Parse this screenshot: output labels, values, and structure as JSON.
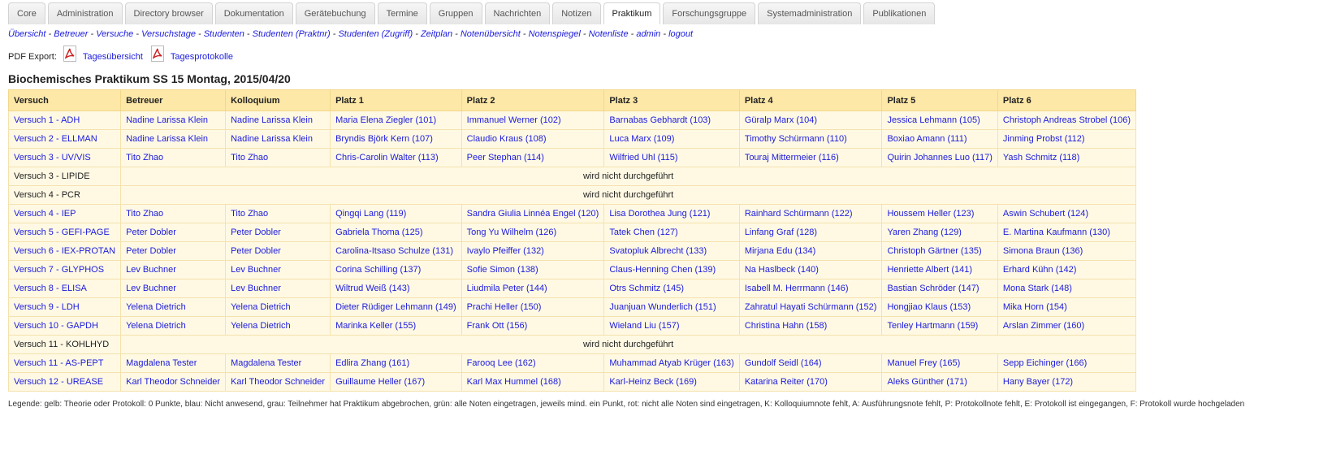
{
  "tabs": [
    {
      "label": "Core",
      "active": false
    },
    {
      "label": "Administration",
      "active": false
    },
    {
      "label": "Directory browser",
      "active": false
    },
    {
      "label": "Dokumentation",
      "active": false
    },
    {
      "label": "Gerätebuchung",
      "active": false
    },
    {
      "label": "Termine",
      "active": false
    },
    {
      "label": "Gruppen",
      "active": false
    },
    {
      "label": "Nachrichten",
      "active": false
    },
    {
      "label": "Notizen",
      "active": false
    },
    {
      "label": "Praktikum",
      "active": true
    },
    {
      "label": "Forschungsgruppe",
      "active": false
    },
    {
      "label": "Systemadministration",
      "active": false
    },
    {
      "label": "Publikationen",
      "active": false
    }
  ],
  "subnav": {
    "separator": " - ",
    "links": [
      "Übersicht",
      "Betreuer",
      "Versuche",
      "Versuchstage",
      "Studenten",
      "Studenten (Praktnr)",
      "Studenten (Zugriff)",
      "Zeitplan",
      "Notenübersicht",
      "Notenspiegel",
      "Notenliste",
      "admin",
      "logout"
    ]
  },
  "pdf_export": {
    "label": "PDF Export:",
    "links": [
      "Tagesübersicht",
      "Tagesprotokolle"
    ]
  },
  "page_title": "Biochemisches Praktikum SS 15 Montag, 2015/04/20",
  "table": {
    "headers": [
      "Versuch",
      "Betreuer",
      "Kolloquium",
      "Platz 1",
      "Platz 2",
      "Platz 3",
      "Platz 4",
      "Platz 5",
      "Platz 6"
    ],
    "rows": [
      {
        "versuch": "Versuch 1 - ADH",
        "cells": [
          "Nadine Larissa Klein",
          "Nadine Larissa Klein",
          "Maria Elena Ziegler (101)",
          "Immanuel Werner (102)",
          "Barnabas Gebhardt (103)",
          "Güralp Marx (104)",
          "Jessica Lehmann (105)",
          "Christoph Andreas Strobel (106)"
        ]
      },
      {
        "versuch": "Versuch 2 - ELLMAN",
        "cells": [
          "Nadine Larissa Klein",
          "Nadine Larissa Klein",
          "Bryndis Björk Kern (107)",
          "Claudio Kraus (108)",
          "Luca Marx (109)",
          "Timothy Schürmann (110)",
          "Boxiao Amann (111)",
          "Jinming Probst (112)"
        ]
      },
      {
        "versuch": "Versuch 3 - UV/VIS",
        "cells": [
          "Tito Zhao",
          "Tito Zhao",
          "Chris-Carolin Walter (113)",
          "Peer Stephan (114)",
          "Wilfried Uhl (115)",
          "Touraj Mittermeier (116)",
          "Quirin Johannes Luo (117)",
          "Yash Schmitz (118)"
        ]
      },
      {
        "versuch": "Versuch 3 - LIPIDE",
        "skipped": "wird nicht durchgeführt"
      },
      {
        "versuch": "Versuch 4 - PCR",
        "skipped": "wird nicht durchgeführt"
      },
      {
        "versuch": "Versuch 4 - IEP",
        "cells": [
          "Tito Zhao",
          "Tito Zhao",
          "Qingqi Lang (119)",
          "Sandra Giulia Linnéa Engel (120)",
          "Lisa Dorothea Jung (121)",
          "Rainhard Schürmann (122)",
          "Houssem Heller (123)",
          "Aswin Schubert (124)"
        ]
      },
      {
        "versuch": "Versuch 5 - GEFI-PAGE",
        "cells": [
          "Peter Dobler",
          "Peter Dobler",
          "Gabriela Thoma (125)",
          "Tong Yu Wilhelm (126)",
          "Tatek Chen (127)",
          "Linfang Graf (128)",
          "Yaren Zhang (129)",
          "E. Martina Kaufmann (130)"
        ]
      },
      {
        "versuch": "Versuch 6 - IEX-PROTAN",
        "cells": [
          "Peter Dobler",
          "Peter Dobler",
          "Carolina-Itsaso Schulze (131)",
          "Ivaylo Pfeiffer (132)",
          "Svatopluk Albrecht (133)",
          "Mirjana Edu (134)",
          "Christoph Gärtner (135)",
          "Simona Braun (136)"
        ]
      },
      {
        "versuch": "Versuch 7 - GLYPHOS",
        "cells": [
          "Lev Buchner",
          "Lev Buchner",
          "Corina Schilling (137)",
          "Sofie Simon (138)",
          "Claus-Henning Chen (139)",
          "Na Haslbeck (140)",
          "Henriette Albert (141)",
          "Erhard Kühn (142)"
        ]
      },
      {
        "versuch": "Versuch 8 - ELISA",
        "cells": [
          "Lev Buchner",
          "Lev Buchner",
          "Wiltrud Weiß (143)",
          "Liudmila Peter (144)",
          "Otrs Schmitz (145)",
          "Isabell M. Herrmann (146)",
          "Bastian Schröder (147)",
          "Mona Stark (148)"
        ]
      },
      {
        "versuch": "Versuch 9 - LDH",
        "cells": [
          "Yelena Dietrich",
          "Yelena Dietrich",
          "Dieter Rüdiger Lehmann (149)",
          "Prachi Heller (150)",
          "Juanjuan Wunderlich (151)",
          "Zahratul Hayati Schürmann (152)",
          "Hongjiao Klaus (153)",
          "Mika Horn (154)"
        ]
      },
      {
        "versuch": "Versuch 10 - GAPDH",
        "cells": [
          "Yelena Dietrich",
          "Yelena Dietrich",
          "Marinka Keller (155)",
          "Frank Ott (156)",
          "Wieland Liu (157)",
          "Christina Hahn (158)",
          "Tenley Hartmann (159)",
          "Arslan Zimmer (160)"
        ]
      },
      {
        "versuch": "Versuch 11 - KOHLHYD",
        "skipped": "wird nicht durchgeführt"
      },
      {
        "versuch": "Versuch 11 - AS-PEPT",
        "cells": [
          "Magdalena Tester",
          "Magdalena Tester",
          "Edlira Zhang (161)",
          "Farooq Lee (162)",
          "Muhammad Atyab Krüger (163)",
          "Gundolf Seidl (164)",
          "Manuel Frey (165)",
          "Sepp Eichinger (166)"
        ]
      },
      {
        "versuch": "Versuch 12 - UREASE",
        "cells": [
          "Karl Theodor Schneider",
          "Karl Theodor Schneider",
          "Guillaume Heller (167)",
          "Karl Max Hummel (168)",
          "Karl-Heinz Beck (169)",
          "Katarina Reiter (170)",
          "Aleks Günther (171)",
          "Hany Bayer (172)"
        ]
      }
    ]
  },
  "legend": "Legende: gelb: Theorie oder Protokoll: 0 Punkte, blau: Nicht anwesend, grau: Teilnehmer hat Praktikum abgebrochen, grün: alle Noten eingetragen, jeweils mind. ein Punkt, rot: nicht alle Noten sind eingetragen, K: Kolloquiumnote fehlt, A: Ausführungsnote fehlt, P: Protokollnote fehlt, E: Protokoll ist eingegangen, F: Protokoll wurde hochgeladen",
  "colors": {
    "link": "#1b1bdd",
    "header_bg": "#fde8a8",
    "cell_bg": "#fff9e4",
    "pdf_red": "#cc1f1f"
  },
  "icons": {
    "pdf_export": "pdf-file-icon"
  }
}
